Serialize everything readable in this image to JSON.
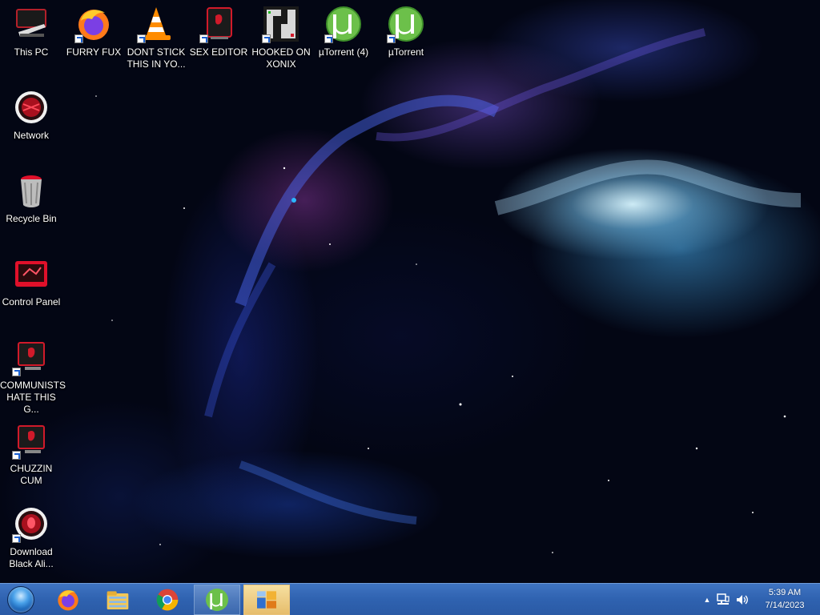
{
  "desktop": {
    "icons": [
      {
        "label": "This PC",
        "icon": "computer-icon"
      },
      {
        "label": "FURRY FUX",
        "icon": "firefox-icon"
      },
      {
        "label": "DONT STICK THIS IN YO...",
        "icon": "vlc-cone-icon"
      },
      {
        "label": "SEX EDITOR",
        "icon": "red-tablet-icon"
      },
      {
        "label": "HOOKED ON XONIX",
        "icon": "xonix-game-icon"
      },
      {
        "label": "µTorrent (4)",
        "icon": "utorrent-icon"
      },
      {
        "label": "µTorrent",
        "icon": "utorrent-icon"
      },
      {
        "label": "Network",
        "icon": "network-orb-icon"
      },
      {
        "label": "Recycle Bin",
        "icon": "recycle-bin-icon"
      },
      {
        "label": "Control Panel",
        "icon": "control-panel-icon"
      },
      {
        "label": "COMMUNISTS HATE THIS G...",
        "icon": "red-monitor-icon"
      },
      {
        "label": "CHUZZIN CUM",
        "icon": "red-monitor-icon"
      },
      {
        "label": "Download Black Ali...",
        "icon": "alien-orb-icon"
      }
    ]
  },
  "taskbar": {
    "items": [
      {
        "icon": "firefox-icon",
        "state": "pinned"
      },
      {
        "icon": "file-explorer-icon",
        "state": "pinned"
      },
      {
        "icon": "chrome-icon",
        "state": "pinned"
      },
      {
        "icon": "utorrent-icon",
        "state": "open"
      },
      {
        "icon": "control-panel-window-icon",
        "state": "active"
      }
    ],
    "tray": {
      "time": "5:39 AM",
      "date": "7/14/2023"
    }
  },
  "colors": {
    "taskbar": "#2f62b0",
    "utorrent_green": "#6cc04a",
    "accent_red": "#e0102a"
  }
}
